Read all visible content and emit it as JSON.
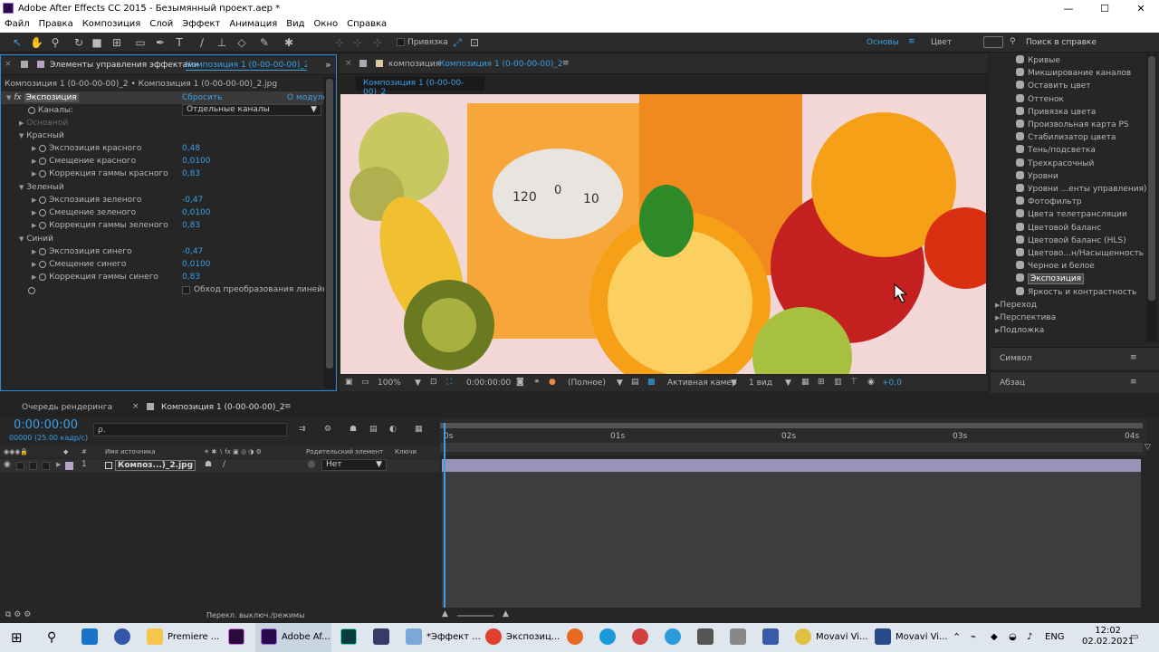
{
  "window": {
    "title": "Adobe After Effects CC 2015 - Безымянный проект.aep *",
    "min": "—",
    "max": "☐",
    "close": "✕"
  },
  "menu": [
    "Файл",
    "Правка",
    "Композиция",
    "Слой",
    "Эффект",
    "Анимация",
    "Вид",
    "Окно",
    "Справка"
  ],
  "toolbar": {
    "snap_label": "Привязка",
    "workspace_basic": "Основы",
    "workspace_menu": "≡",
    "workspace_color": "Цвет",
    "search_placeholder": "Поиск в справке"
  },
  "effects_panel": {
    "tab_title": "Элементы управления эффектами",
    "tab_comp": "Композиция 1 (0-00-00-00)_2.jpg",
    "breadcrumb": "Композиция 1 (0-00-00-00)_2 • Композиция 1 (0-00-00-00)_2.jpg",
    "effect_name": "Экспозиция",
    "reset": "Сбросить",
    "about": "О модуле",
    "channels_label": "Каналы:",
    "channels_value": "Отдельные каналы",
    "basic": "Основной",
    "groups": [
      {
        "name": "Красный",
        "params": [
          {
            "label": "Экспозиция красного",
            "value": "0,48"
          },
          {
            "label": "Смещение красного",
            "value": "0,0100"
          },
          {
            "label": "Коррекция гаммы красного",
            "value": "0,83"
          }
        ]
      },
      {
        "name": "Зеленый",
        "params": [
          {
            "label": "Экспозиция зеленого",
            "value": "-0,47"
          },
          {
            "label": "Смещение зеленого",
            "value": "0,0100"
          },
          {
            "label": "Коррекция гаммы зеленого",
            "value": "0,83"
          }
        ]
      },
      {
        "name": "Синий",
        "params": [
          {
            "label": "Экспозиция синего",
            "value": "-0,47"
          },
          {
            "label": "Смещение синего",
            "value": "0,0100"
          },
          {
            "label": "Коррекция гаммы синего",
            "value": "0,83"
          }
        ]
      }
    ],
    "bypass_label": "Обход преобразования линейн"
  },
  "comp_panel": {
    "tab_label": "композиция",
    "tab_comp": "Композиция 1 (0-00-00-00)_2",
    "subtab": "Композиция 1 (0-00-00-00)_2",
    "zoom": "100%",
    "timecode": "0:00:00:00",
    "resolution": "(Полное)",
    "camera": "Активная камер",
    "views": "1 вид",
    "exposure": "+0,0",
    "scale_labels": [
      "120",
      "0",
      "10"
    ]
  },
  "effects_list": {
    "items": [
      "Кривые",
      "Микширование каналов",
      "Оставить цвет",
      "Оттенок",
      "Привязка цвета",
      "Произвольная карта PS",
      "Стабилизатор цвета",
      "Тень/подсветка",
      "Трехкрасочный",
      "Уровни",
      "Уровни ...енты управления)",
      "Фотофильтр",
      "Цвета телетрансляции",
      "Цветовой баланс",
      "Цветовой баланс (HLS)",
      "Цветово...н/Насыщенность",
      "Черное и белое",
      "Экспозиция",
      "Яркость и контрастность"
    ],
    "selected": "Экспозиция",
    "categories": [
      "Переход",
      "Перспектива",
      "Подложка"
    ],
    "symbol_panel": "Символ",
    "paragraph_panel": "Абзац",
    "panel_menu": "≡"
  },
  "timeline": {
    "render_tab": "Очередь рендеринга",
    "comp_tab": "Композиция 1 (0-00-00-00)_2",
    "menu": "≡",
    "close": "×",
    "timecode": "0:00:00:00",
    "fps": "00000 (25.00 кадр/с)",
    "search_placeholder": "ρ.",
    "col_num": "#",
    "col_source": "Имя источника",
    "col_parent": "Родительский элемент",
    "col_keys": "Ключи",
    "layer_num": "1",
    "layer_name": "Композ...)_2.jpg",
    "layer_parent": "Нет",
    "ruler": [
      "0s",
      "01s",
      "02s",
      "03s",
      "04s"
    ],
    "footer": "Перекл. выключ./режимы"
  },
  "taskbar": {
    "items": [
      "Premiere ...",
      "Adobe Af...",
      "*Эффект ...",
      "Экспозиц...",
      "Movavi Vi...",
      "Movavi Vi..."
    ],
    "lang": "ENG",
    "time": "12:02",
    "date": "02.02.2021"
  },
  "colors": {
    "accent": "#3aa0e8",
    "selection": "#2c8ad8"
  }
}
